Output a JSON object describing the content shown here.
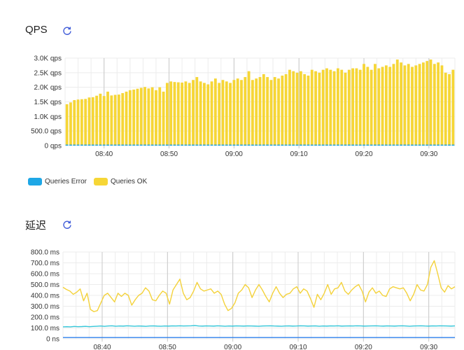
{
  "sections": {
    "qps": {
      "title": "QPS"
    },
    "latency": {
      "title": "延迟"
    }
  },
  "colors": {
    "ok": "#f6d636",
    "ok_stroke": "#e6c21f",
    "error": "#1ea7e6",
    "lat_yellow": "#f4d23a",
    "lat_cyan": "#34c6d8",
    "lat_blue": "#2f80ed",
    "refresh": "#3f5bd8",
    "grid_minor": "#ececec",
    "grid_major": "#c9c9c9"
  },
  "chart_data": [
    {
      "type": "bar",
      "stacked": true,
      "x_start": "08:34",
      "x_end": "09:34",
      "x_ticks": [
        "08:40",
        "08:50",
        "09:00",
        "09:10",
        "09:20",
        "09:30"
      ],
      "y_ticks": [
        "0 qps",
        "500.0 qps",
        "1.0K qps",
        "1.5K qps",
        "2.0K qps",
        "2.5K qps",
        "3.0K qps"
      ],
      "ylim": [
        0,
        3000
      ],
      "legend": [
        "Queries Error",
        "Queries OK"
      ],
      "legend_position": "bottom-left",
      "series": [
        {
          "name": "Queries OK",
          "values": [
            1420,
            1480,
            1560,
            1580,
            1590,
            1600,
            1650,
            1660,
            1710,
            1780,
            1700,
            1850,
            1720,
            1740,
            1750,
            1800,
            1850,
            1900,
            1920,
            1950,
            1980,
            2010,
            1960,
            2000,
            1900,
            2000,
            1850,
            2150,
            2200,
            2180,
            2170,
            2160,
            2200,
            2150,
            2250,
            2350,
            2200,
            2150,
            2100,
            2200,
            2300,
            2150,
            2250,
            2200,
            2150,
            2250,
            2300,
            2250,
            2350,
            2550,
            2250,
            2300,
            2350,
            2450,
            2350,
            2250,
            2350,
            2300,
            2400,
            2450,
            2600,
            2550,
            2500,
            2550,
            2450,
            2400,
            2600,
            2550,
            2500,
            2600,
            2650,
            2600,
            2550,
            2650,
            2600,
            2500,
            2600,
            2650,
            2650,
            2600,
            2800,
            2700,
            2600,
            2800,
            2650,
            2700,
            2750,
            2700,
            2800,
            2950,
            2850,
            2750,
            2800,
            2700,
            2750,
            2800,
            2850,
            2900,
            2950,
            2800,
            2850,
            2750,
            2500,
            2450,
            2600
          ]
        },
        {
          "name": "Queries Error",
          "values": [
            10,
            10,
            10,
            10,
            10,
            10,
            10,
            10,
            10,
            10,
            10,
            10,
            10,
            10,
            10,
            10,
            10,
            10,
            10,
            10,
            10,
            10,
            10,
            10,
            10,
            10,
            10,
            10,
            10,
            10,
            10,
            10,
            10,
            10,
            10,
            10,
            10,
            10,
            10,
            10,
            10,
            10,
            10,
            10,
            10,
            10,
            10,
            10,
            10,
            10,
            10,
            10,
            10,
            10,
            10,
            10,
            10,
            10,
            10,
            10,
            10,
            10,
            10,
            10,
            10,
            10,
            10,
            10,
            10,
            10,
            10,
            10,
            10,
            10,
            10,
            10,
            10,
            10,
            10,
            10,
            10,
            10,
            10,
            10,
            10,
            10,
            10,
            10,
            10,
            10,
            10,
            10,
            10,
            10,
            10,
            10,
            10,
            10,
            10,
            10,
            10,
            10,
            10,
            10,
            10
          ]
        }
      ]
    },
    {
      "type": "line",
      "x_start": "08:34",
      "x_end": "09:34",
      "x_ticks": [
        "08:40",
        "08:50",
        "09:00",
        "09:10",
        "09:20",
        "09:30"
      ],
      "y_ticks": [
        "0 ns",
        "100.0 ms",
        "200.0 ms",
        "300.0 ms",
        "400.0 ms",
        "500.0 ms",
        "600.0 ms",
        "700.0 ms",
        "800.0 ms"
      ],
      "ylim": [
        0,
        800
      ],
      "series": [
        {
          "color_key": "lat_yellow",
          "values": [
            475,
            455,
            440,
            410,
            430,
            460,
            350,
            420,
            270,
            250,
            260,
            330,
            400,
            420,
            380,
            340,
            420,
            390,
            420,
            400,
            310,
            360,
            400,
            420,
            470,
            440,
            360,
            350,
            400,
            440,
            420,
            320,
            450,
            500,
            550,
            420,
            360,
            380,
            440,
            520,
            460,
            440,
            450,
            460,
            420,
            440,
            410,
            320,
            260,
            280,
            330,
            420,
            450,
            500,
            470,
            380,
            450,
            500,
            450,
            390,
            340,
            420,
            480,
            420,
            380,
            410,
            420,
            460,
            480,
            420,
            460,
            440,
            370,
            290,
            410,
            360,
            420,
            500,
            410,
            460,
            470,
            520,
            440,
            410,
            450,
            480,
            500,
            440,
            340,
            430,
            470,
            420,
            440,
            400,
            390,
            460,
            480,
            470,
            460,
            470,
            420,
            350,
            410,
            500,
            450,
            440,
            500,
            660,
            720,
            600,
            470,
            430,
            490,
            460,
            480
          ]
        },
        {
          "color_key": "lat_cyan",
          "values": [
            110,
            112,
            110,
            114,
            112,
            113,
            115,
            112,
            114,
            116,
            118,
            115,
            118,
            120,
            116,
            118,
            117,
            120,
            118,
            116,
            118,
            117,
            115,
            118,
            119,
            117,
            116,
            118,
            117,
            119,
            118,
            120,
            118,
            119,
            120,
            122,
            118,
            117,
            119,
            118,
            117,
            120,
            118,
            116,
            118,
            117,
            119,
            118,
            117,
            119,
            118,
            117,
            116,
            118,
            119,
            120,
            118,
            117,
            116,
            118,
            119,
            117,
            118,
            120,
            119,
            117,
            118,
            119,
            116,
            118,
            117,
            119,
            118,
            120,
            117,
            118,
            119,
            118,
            120,
            119,
            117,
            118,
            119,
            120,
            118,
            117,
            119,
            118,
            117,
            119,
            120,
            118,
            116,
            118,
            119,
            120,
            118,
            117,
            119,
            118,
            120,
            119,
            118,
            117,
            119
          ]
        },
        {
          "color_key": "lat_blue",
          "values": [
            12,
            12,
            12,
            12,
            12,
            12,
            12,
            12,
            12,
            12,
            12,
            12,
            12,
            12,
            12,
            12,
            12,
            12,
            12,
            12,
            12,
            12,
            12,
            12,
            12,
            12,
            12,
            12,
            12,
            12,
            12,
            12,
            12,
            12,
            12,
            12,
            12,
            12,
            12,
            12,
            12,
            12,
            12,
            12,
            12,
            12,
            12,
            12,
            12,
            12,
            12,
            12,
            12,
            12,
            12,
            12,
            12,
            12,
            12,
            12,
            12,
            12,
            12,
            12,
            12,
            12,
            12,
            12,
            12,
            12,
            12,
            12,
            12,
            12,
            12,
            12,
            12,
            12,
            12,
            12,
            12,
            12,
            12,
            12,
            12,
            12,
            12,
            12,
            12,
            12,
            12,
            12,
            12,
            12,
            12,
            12,
            12,
            12,
            12,
            12,
            12,
            12,
            12,
            12,
            12
          ]
        }
      ]
    }
  ]
}
